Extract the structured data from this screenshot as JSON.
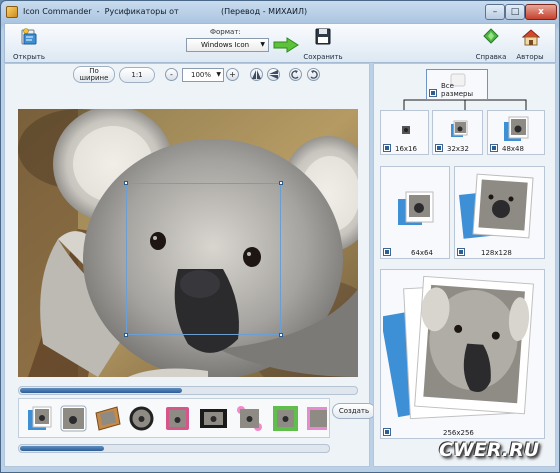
{
  "window": {
    "title": "Icon Commander  -  Русификаторы от",
    "title_tail": "(Перевод - МИХАИЛ)",
    "min_label": "–",
    "max_label": "□",
    "close_label": "x"
  },
  "toolbar": {
    "open_label": "Открыть",
    "format_label": "Формат:",
    "format_value": "Windows Icon",
    "save_label": "Сохранить",
    "help_label": "Справка",
    "authors_label": "Авторы"
  },
  "controls": {
    "fit_width_line1": "По",
    "fit_width_line2": "ширине",
    "one_to_one": "1:1",
    "zoom_out": "-",
    "zoom_value": "100%",
    "zoom_in": "+"
  },
  "strip": {
    "create_label": "Создать",
    "thumb_count": 9
  },
  "sizes": {
    "all_label": "Все размеры",
    "s16": "16x16",
    "s32": "32x32",
    "s48": "48x48",
    "s64": "64x64",
    "s128": "128x128",
    "s256": "256x256"
  },
  "watermark": "CWER.RU",
  "scroll": {
    "photo_h_fraction": 0.48,
    "strip_h_fraction": 0.27
  }
}
